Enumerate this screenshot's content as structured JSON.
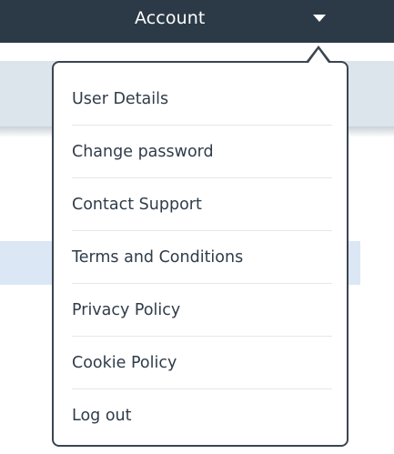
{
  "header": {
    "account_label": "Account",
    "caret_icon": "caret-down-icon"
  },
  "menu": {
    "items": [
      {
        "label": "User Details"
      },
      {
        "label": "Change password"
      },
      {
        "label": "Contact Support"
      },
      {
        "label": "Terms and Conditions"
      },
      {
        "label": "Privacy Policy"
      },
      {
        "label": "Cookie Policy"
      },
      {
        "label": "Log out"
      }
    ]
  },
  "colors": {
    "header_bg": "#2c3a47",
    "menu_border": "#3a4550",
    "text": "#2f3c4a",
    "highlight": "#dbe7f4"
  }
}
